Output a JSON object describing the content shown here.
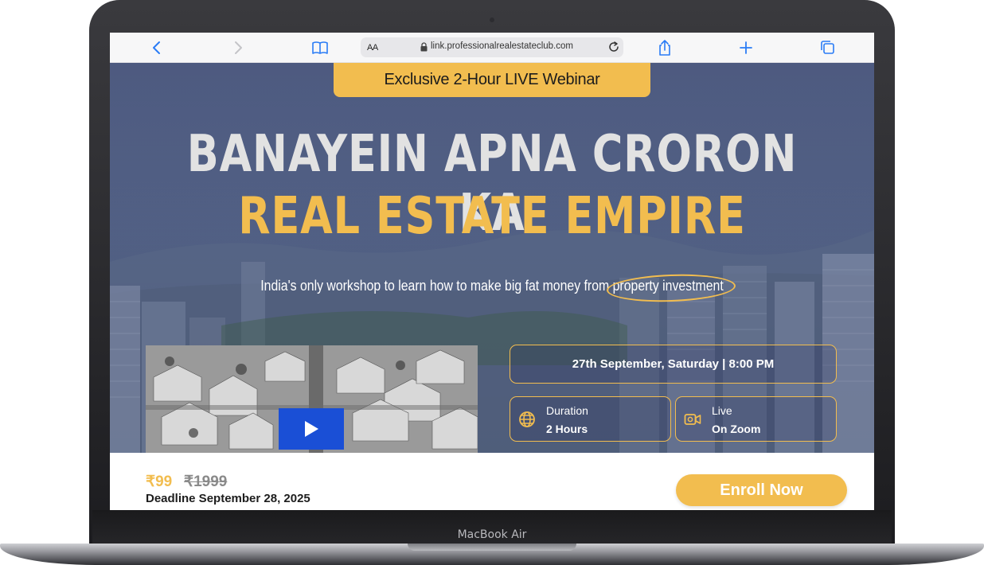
{
  "device": {
    "label": "MacBook Air"
  },
  "browser": {
    "url": "link.professionalrealestateclub.com",
    "aa_label": "AA",
    "icons": [
      "back-icon",
      "forward-icon",
      "bookmarks-icon",
      "lock-icon",
      "reload-icon",
      "share-icon",
      "new-tab-icon",
      "tabs-icon"
    ]
  },
  "hero": {
    "badge": "Exclusive 2-Hour LIVE Webinar",
    "headline_line1": "BANAYEIN APNA CRORON KA",
    "headline_line2": "REAL ESTATE EMPIRE",
    "subline": "India's only workshop to learn how to make big fat money from property investment"
  },
  "event": {
    "date_time": "27th September, Saturday | 8:00 PM",
    "duration_label": "Duration",
    "duration_value": "2 Hours",
    "mode_label": "Live",
    "mode_value": "On Zoom"
  },
  "footer": {
    "price": "₹99",
    "old_price": "₹1999",
    "deadline": "Deadline September 28, 2025",
    "cta": "Enroll Now"
  },
  "colors": {
    "accent": "#f2bd4f",
    "play_button": "#1a4fd6",
    "hero_overlay": "#3c4870"
  }
}
